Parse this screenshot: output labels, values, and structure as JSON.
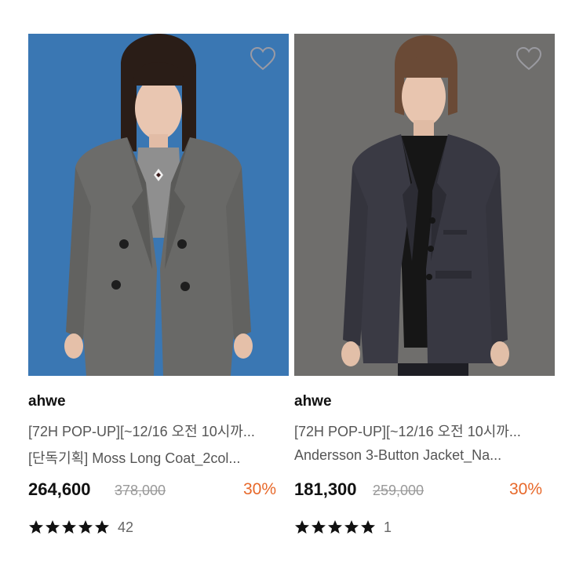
{
  "colors": {
    "discount": "#e7682a",
    "text_primary": "#111111",
    "text_secondary": "#555555",
    "strikethrough": "#999999",
    "left_photo_bg": "#3b78b4",
    "right_photo_bg": "#6e6d6b"
  },
  "products": [
    {
      "brand": "ahwe",
      "title_line1": "[72H POP-UP][~12/16 오전 10시까...",
      "title_line2": "[단독기획] Moss Long Coat_2col...",
      "price": "264,600",
      "original_price": "378,000",
      "discount": "30%",
      "rating_stars": 5,
      "review_count": "42",
      "wishlist_icon": "heart-outline-icon"
    },
    {
      "brand": "ahwe",
      "title_line1": "[72H POP-UP][~12/16 오전 10시까...",
      "title_line2": "Andersson 3-Button Jacket_Na...",
      "price": "181,300",
      "original_price": "259,000",
      "discount": "30%",
      "rating_stars": 5,
      "review_count": "1",
      "wishlist_icon": "heart-outline-icon"
    }
  ]
}
